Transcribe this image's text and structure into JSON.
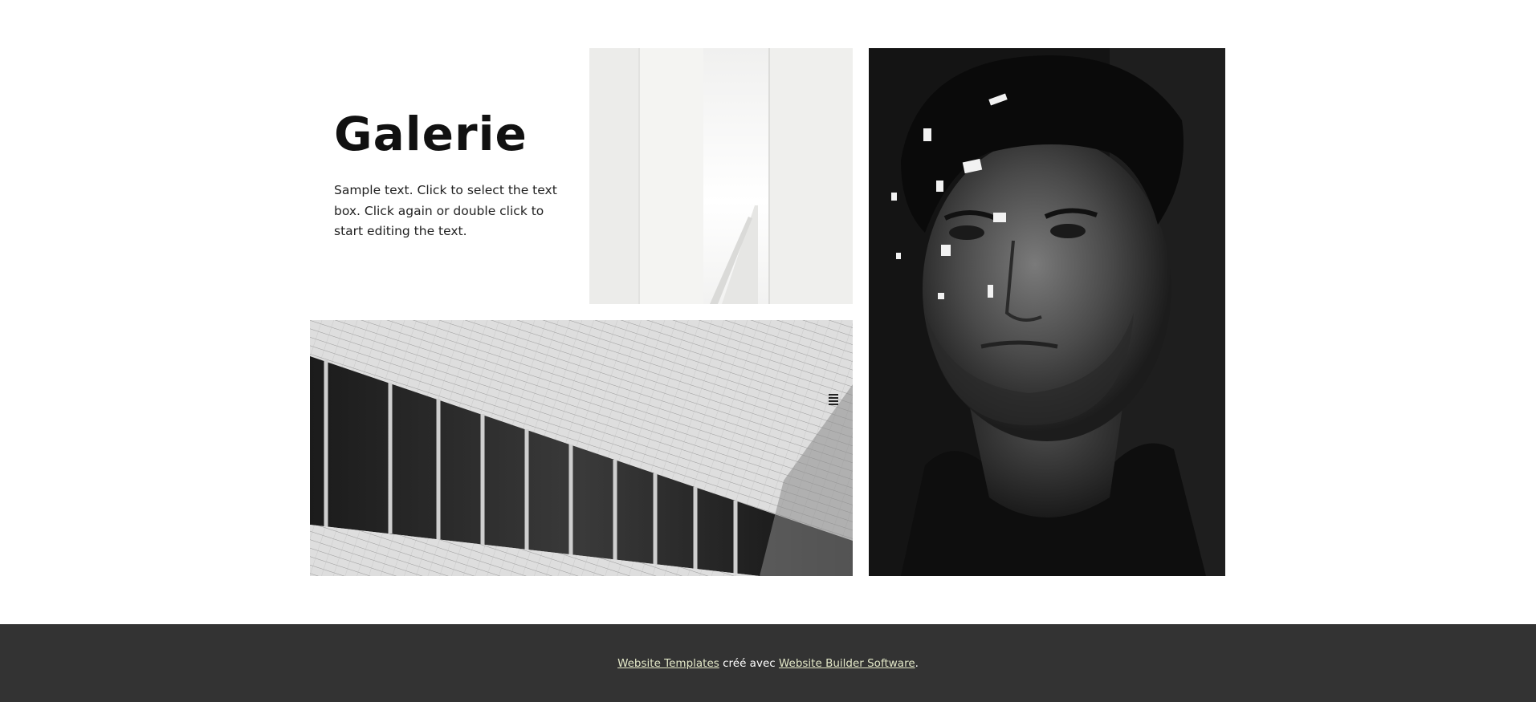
{
  "gallery": {
    "title": "Galerie",
    "text": "Sample text. Click to select the text box. Click again or double click to start editing the text.",
    "images": [
      {
        "name": "white-architecture-photo"
      },
      {
        "name": "building-facade-photo"
      },
      {
        "name": "man-portrait-photo"
      }
    ]
  },
  "footer": {
    "link1": "Website Templates",
    "middle": " créé avec ",
    "link2": "Website Builder Software",
    "end": ".",
    "link_color": "#e3e8c8",
    "background": "#333333"
  }
}
